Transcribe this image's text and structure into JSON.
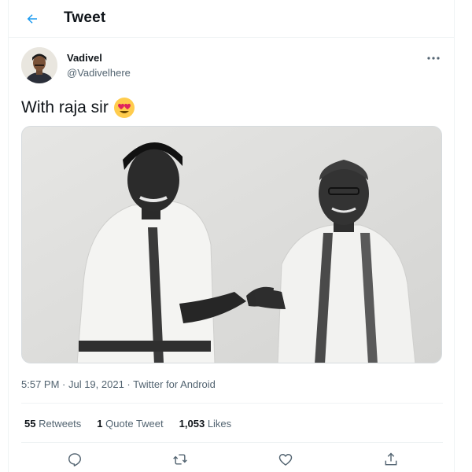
{
  "header": {
    "title": "Tweet",
    "back_icon": "back-arrow-icon"
  },
  "author": {
    "name": "Vadivel",
    "handle": "@Vadivelhere"
  },
  "tweet": {
    "text": "With raja sir",
    "emoji": "smiling-face-with-heart-eyes"
  },
  "meta": {
    "timestamp": "5:57 PM · Jul 19, 2021 · Twitter for Android"
  },
  "stats": {
    "retweets_count": "55",
    "retweets_label": "Retweets",
    "quotes_count": "1",
    "quotes_label": "Quote Tweet",
    "likes_count": "1,053",
    "likes_label": "Likes"
  },
  "actions": [
    "reply-icon",
    "retweet-icon",
    "like-icon",
    "share-icon"
  ],
  "colors": {
    "accent": "#1d9bf0",
    "text": "#0f1419",
    "secondary": "#536471",
    "border": "#eff3f4"
  }
}
